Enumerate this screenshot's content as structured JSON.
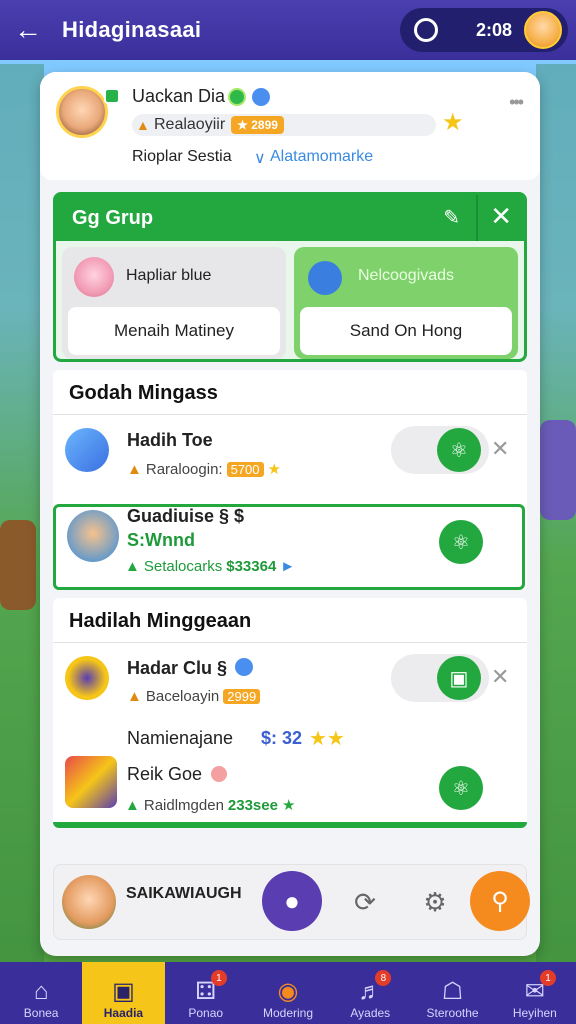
{
  "header": {
    "title": "Hidaginasaai",
    "time": "2:08"
  },
  "profile": {
    "name": "Uackan Dia",
    "level_label": "Realaoyiir",
    "level_badge": "★ 2899",
    "subtitle": "Rioplar Sestia",
    "link_text": "Alatamomarke"
  },
  "group": {
    "title": "Gg Grup",
    "members": [
      {
        "name": "Hapliar blue",
        "action": "Menaih Matiney"
      },
      {
        "name": "Nelcoogivads",
        "action": "Sand On Hong"
      }
    ]
  },
  "section1": {
    "title": "Godah Mingass",
    "items": [
      {
        "name": "Hadih Toe",
        "sub": "Raraloogin:",
        "badge": "5700"
      },
      {
        "name": "Guadiuise § $",
        "name2": "S:Wnnd",
        "sub": "Setalocarks",
        "badge": "$33364"
      }
    ]
  },
  "section2": {
    "title": "Hadilah Minggeaan",
    "items": [
      {
        "name": "Hadar Clu §",
        "sub": "Baceloayin",
        "badge": "2999"
      },
      {
        "name": "Namienajane",
        "value": "$: 32",
        "name2": "Reik Goe",
        "sub": "Raidlmgden",
        "badge": "233see"
      }
    ]
  },
  "action_bar": {
    "label": "SAIKAWIAUGH"
  },
  "nav": [
    {
      "label": "Bonea",
      "icon": "home-icon"
    },
    {
      "label": "Haadia",
      "icon": "screen-icon",
      "active": true
    },
    {
      "label": "Ponao",
      "icon": "dice-icon",
      "badge": "1"
    },
    {
      "label": "Modering",
      "icon": "coin-icon"
    },
    {
      "label": "Ayades",
      "icon": "bell-icon",
      "badge": "8"
    },
    {
      "label": "Steroothe",
      "icon": "shop-icon"
    },
    {
      "label": "Heyihen",
      "icon": "chat-icon",
      "badge": "1"
    }
  ],
  "colors": {
    "primary": "#3a2f9a",
    "accent_green": "#22a83f",
    "accent_orange": "#f58a1f",
    "accent_gold": "#f6c519"
  }
}
